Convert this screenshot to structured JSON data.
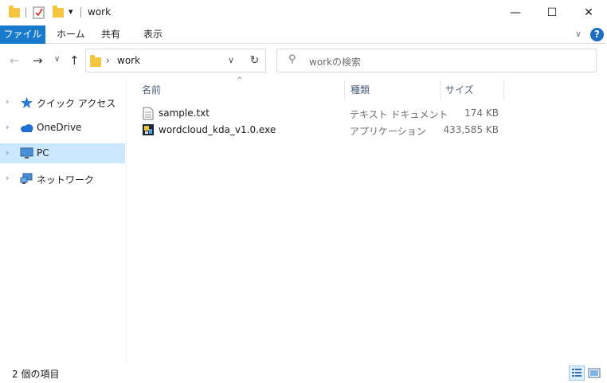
{
  "window": {
    "title": "work",
    "qa_dropdown": "▾",
    "minimize": "—",
    "maximize": "☐",
    "close": "✕"
  },
  "ribbon": {
    "tabs": [
      "ファイル",
      "ホーム",
      "共有",
      "表示"
    ],
    "collapse": "∨",
    "help": "?"
  },
  "addressbar": {
    "back": "←",
    "forward": "→",
    "recent": "∨",
    "up": "↑",
    "crumb_sep": "›",
    "crumb": "work",
    "dropdown": "∨",
    "refresh": "↻"
  },
  "search": {
    "placeholder": "workの検索",
    "icon": "⚲"
  },
  "navpane": {
    "items": [
      {
        "label": "クイック アクセス",
        "icon": "star-icon"
      },
      {
        "label": "OneDrive",
        "icon": "cloud-icon"
      },
      {
        "label": "PC",
        "icon": "monitor-icon",
        "selected": true
      },
      {
        "label": "ネットワーク",
        "icon": "network-icon"
      }
    ],
    "chevron": "›"
  },
  "columns": {
    "name": "名前",
    "type": "種類",
    "size": "サイズ",
    "sort_arrow": "^"
  },
  "files": [
    {
      "name": "sample.txt",
      "type": "テキスト ドキュメント",
      "size": "174 KB",
      "icon": "text-file-icon"
    },
    {
      "name": "wordcloud_kda_v1.0.exe",
      "type": "アプリケーション",
      "size": "433,585 KB",
      "icon": "exe-file-icon"
    }
  ],
  "status": {
    "count": "2 個の項目"
  },
  "colors": {
    "file_tab": "#1979ca",
    "selected_nav": "#cce8ff",
    "header_text": "#4c607a"
  }
}
